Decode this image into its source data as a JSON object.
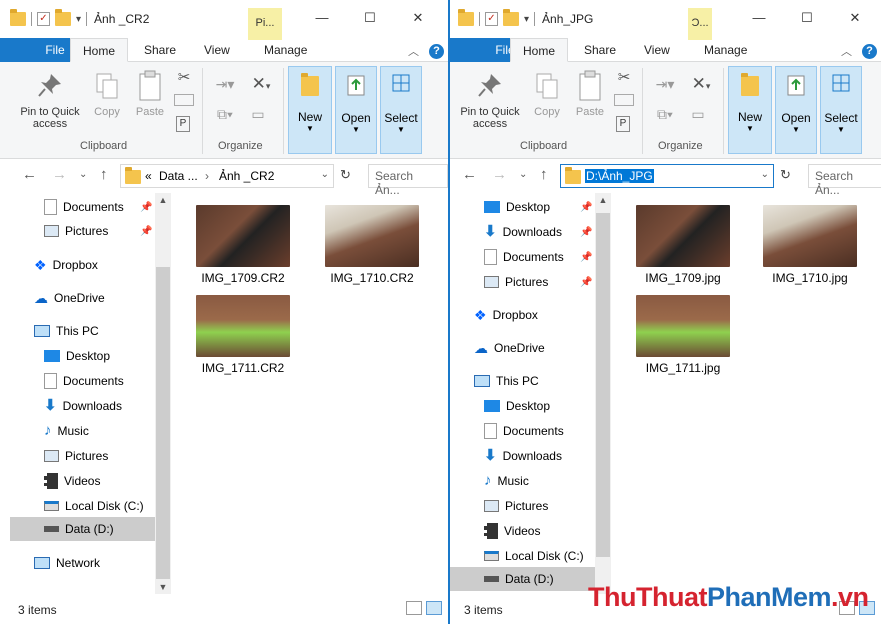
{
  "left": {
    "title": "Ảnh _CR2",
    "context_tab": "Pi...",
    "tabs": {
      "file": "File",
      "home": "Home",
      "share": "Share",
      "view": "View",
      "manage": "Manage"
    },
    "ribbon": {
      "pin_l1": "Pin to Quick",
      "pin_l2": "access",
      "copy": "Copy",
      "paste": "Paste",
      "clipboard": "Clipboard",
      "organize": "Organize",
      "new": "New",
      "open": "Open",
      "select": "Select"
    },
    "address": {
      "crumb1": "Data ...",
      "crumb2": "Ảnh _CR2",
      "prefix": "«"
    },
    "search_placeholder": "Search Ản...",
    "nav": [
      "Documents",
      "Pictures",
      "Dropbox",
      "OneDrive",
      "This PC",
      "Desktop",
      "Documents",
      "Downloads",
      "Music",
      "Pictures",
      "Videos",
      "Local Disk (C:)",
      "Data (D:)",
      "Network"
    ],
    "files": [
      "IMG_1709.CR2",
      "IMG_1710.CR2",
      "IMG_1711.CR2"
    ],
    "status": "3 items"
  },
  "right": {
    "title": "Ảnh_JPG",
    "context_tab": "Ͻ...",
    "tabs": {
      "file": "File",
      "home": "Home",
      "share": "Share",
      "view": "View",
      "manage": "Manage"
    },
    "ribbon": {
      "pin_l1": "Pin to Quick",
      "pin_l2": "access",
      "copy": "Copy",
      "paste": "Paste",
      "clipboard": "Clipboard",
      "organize": "Organize",
      "new": "New",
      "open": "Open",
      "select": "Select"
    },
    "address": {
      "path": "D:\\Ảnh_JPG"
    },
    "search_placeholder": "Search Ản...",
    "nav": [
      "Desktop",
      "Downloads",
      "Documents",
      "Pictures",
      "Dropbox",
      "OneDrive",
      "This PC",
      "Desktop",
      "Documents",
      "Downloads",
      "Music",
      "Pictures",
      "Videos",
      "Local Disk (C:)",
      "Data (D:)"
    ],
    "files": [
      "IMG_1709.jpg",
      "IMG_1710.jpg",
      "IMG_1711.jpg"
    ],
    "status": "3 items"
  },
  "watermark": {
    "part1": "ThuThuat",
    "part2": "PhanMem",
    "part3": ".vn"
  },
  "colors": {
    "accent": "#1979ca",
    "selected_nav": "#cccccc",
    "context_tab": "#f7f0a6",
    "wm_red": "#d5232f",
    "wm_blue": "#1f6eb8"
  }
}
